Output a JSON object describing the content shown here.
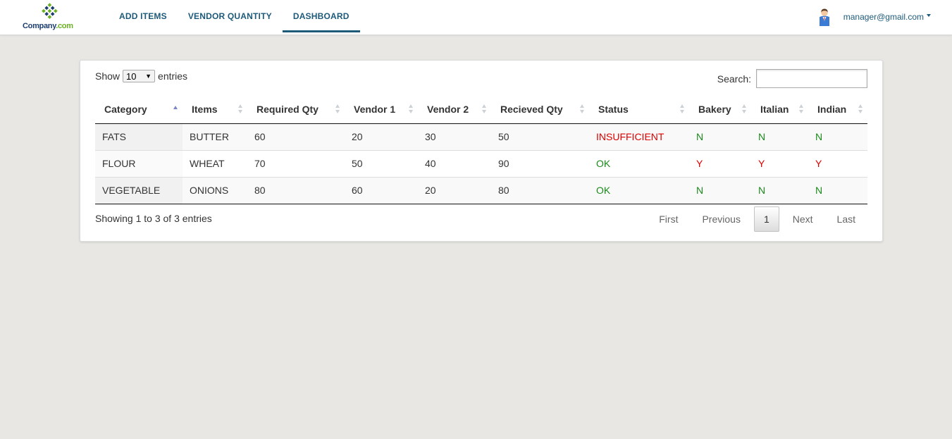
{
  "brand": {
    "name": "Company",
    "suffix": ".com"
  },
  "nav": {
    "items": [
      {
        "label": "ADD ITEMS",
        "active": false
      },
      {
        "label": "VENDOR QUANTITY",
        "active": false
      },
      {
        "label": "DASHBOARD",
        "active": true
      }
    ]
  },
  "user": {
    "email": "manager@gmail.com"
  },
  "table_controls": {
    "show_label": "Show",
    "page_size": "10",
    "entries_label": "entries",
    "search_label": "Search:",
    "search_value": ""
  },
  "table": {
    "columns": [
      "Category",
      "Items",
      "Required Qty",
      "Vendor 1",
      "Vendor 2",
      "Recieved Qty",
      "Status",
      "Bakery",
      "Italian",
      "Indian"
    ],
    "sorted_column": "Category",
    "sort_direction": "ascending",
    "rows": [
      [
        "FATS",
        "BUTTER",
        "60",
        "20",
        "30",
        "50",
        "INSUFFICIENT",
        "N",
        "N",
        "N"
      ],
      [
        "FLOUR",
        "WHEAT",
        "70",
        "50",
        "40",
        "90",
        "OK",
        "Y",
        "Y",
        "Y"
      ],
      [
        "VEGETABLE",
        "ONIONS",
        "80",
        "60",
        "20",
        "80",
        "OK",
        "N",
        "N",
        "N"
      ]
    ]
  },
  "footer": {
    "info": "Showing 1 to 3 of 3 entries",
    "pagination": {
      "first": "First",
      "previous": "Previous",
      "current": "1",
      "next": "Next",
      "last": "Last"
    }
  },
  "colors": {
    "nav_text": "#1d5a7a",
    "status_bad": "#e00000",
    "status_ok": "#1a8a1a",
    "page_bg": "#e8e7e4",
    "logo_green": "#6ab023",
    "logo_navy": "#1c3d6e"
  },
  "icons": {
    "logo": "diamond-grid-logo-icon",
    "user": "user-avatar-icon",
    "caret": "caret-down-icon",
    "sort": "sort-arrows-icon"
  }
}
